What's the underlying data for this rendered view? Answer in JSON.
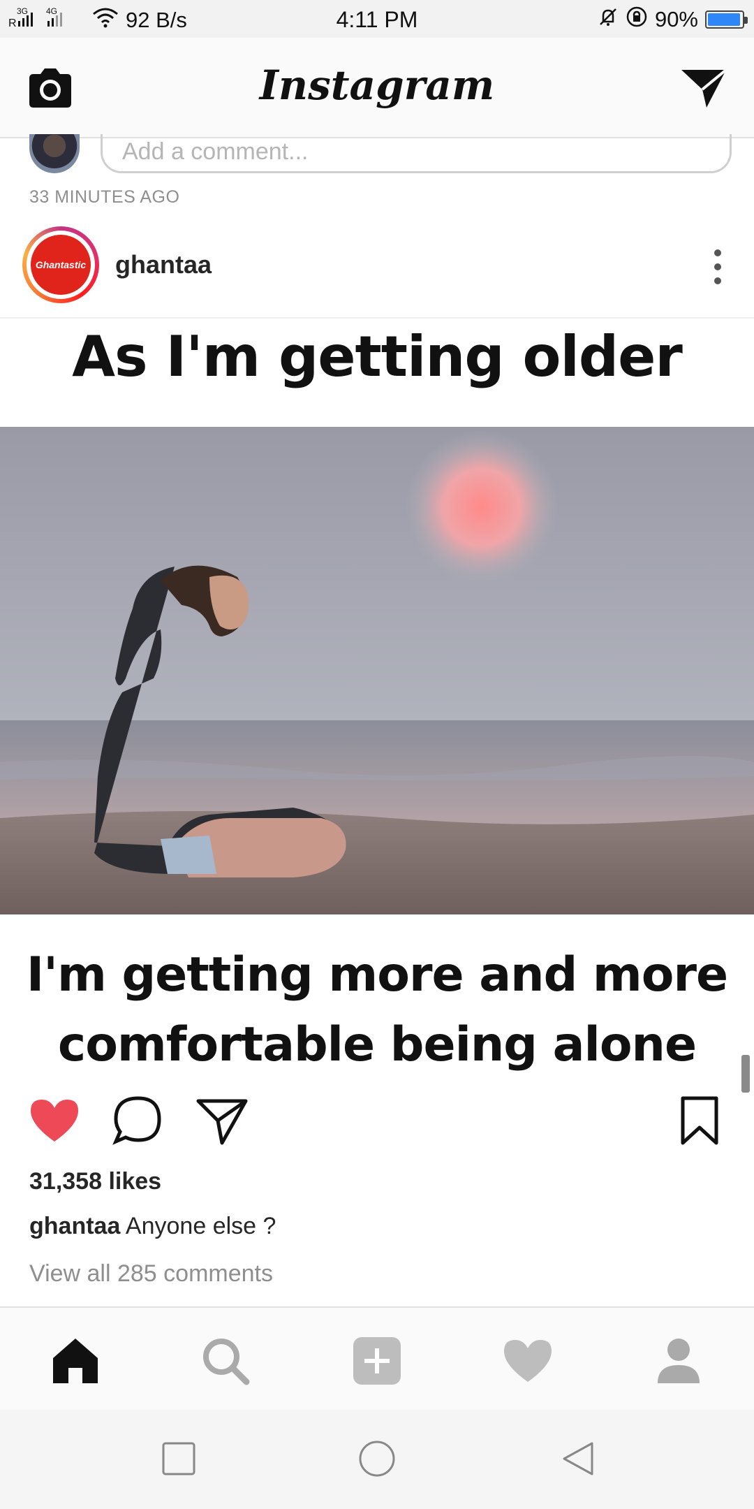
{
  "status_bar": {
    "network": "3G 4G",
    "speed": "92 B/s",
    "time": "4:11 PM",
    "battery": "90%",
    "battery_level": 0.9,
    "battery_color": "#2f86f6"
  },
  "header": {
    "title": "Instagram",
    "left_icon": "camera-icon",
    "right_icon": "direct-message-icon"
  },
  "previous_post": {
    "comment_placeholder": "Add a comment...",
    "time_ago": "33 MINUTES AGO"
  },
  "post": {
    "username": "ghantaa",
    "avatar_text": "Ghantastic",
    "image_text_top": "As I'm getting older",
    "image_text_bottom_line1": "I'm getting more and more",
    "image_text_bottom_line2": "comfortable being alone",
    "likes": "31,358 likes",
    "caption_user": "ghantaa",
    "caption_text": " Anyone else ?",
    "view_comments": "View all 285 comments",
    "liked": true,
    "like_color": "#ed4956"
  },
  "bottom_nav": {
    "items": [
      "home-icon",
      "search-icon",
      "add-post-icon",
      "activity-heart-icon",
      "profile-icon"
    ],
    "active": "home-icon"
  },
  "system_nav": {
    "items": [
      "recents-square-icon",
      "home-circle-icon",
      "back-triangle-icon"
    ]
  }
}
